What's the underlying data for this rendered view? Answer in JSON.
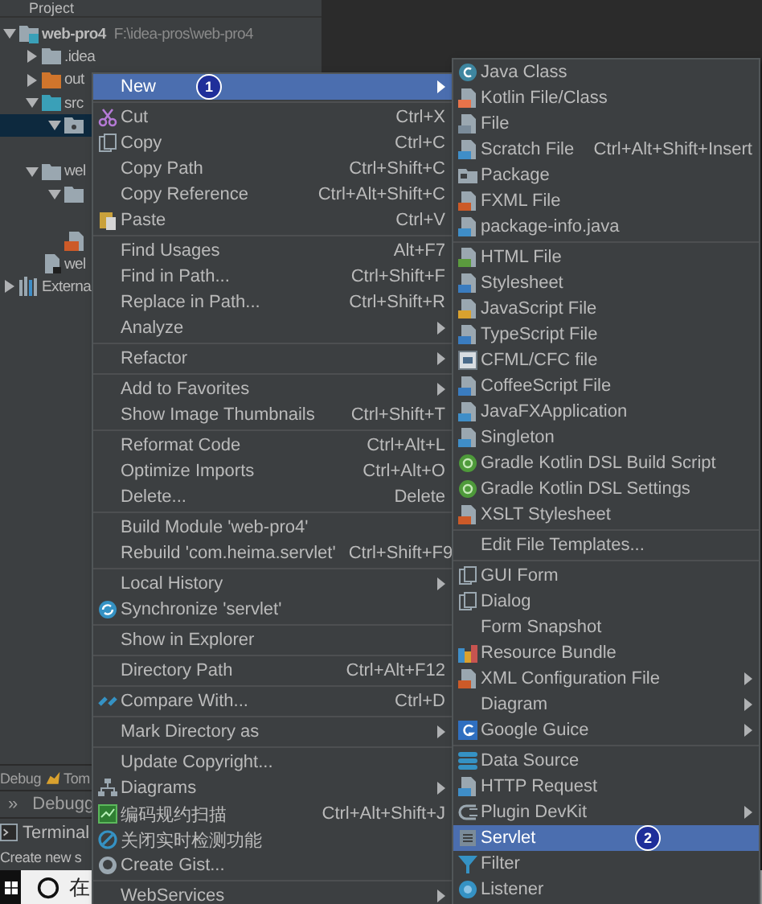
{
  "project_panel": {
    "title": "Project",
    "tree": [
      {
        "kind": "module",
        "label": "web-pro4",
        "path": "F:\\idea-pros\\web-pro4",
        "expanded": true,
        "selected": false,
        "children": [
          {
            "kind": "folder",
            "label": ".idea",
            "expanded": false,
            "selected": false
          },
          {
            "kind": "excluded",
            "label": "out",
            "expanded": false,
            "selected": false
          },
          {
            "kind": "source",
            "label": "src",
            "expanded": true,
            "selected": false,
            "children": [
              {
                "kind": "package",
                "expanded": true,
                "selected": true
              }
            ]
          },
          {
            "kind": "folder",
            "label": "wel",
            "expanded": true,
            "selected": false,
            "children": [
              {
                "kind": "folder",
                "expanded": true,
                "selected": false
              },
              {
                "kind": "jsp",
                "selected": false
              }
            ]
          },
          {
            "kind": "webfile",
            "label": "wel",
            "selected": false
          }
        ]
      },
      {
        "kind": "library",
        "label": "Externa",
        "expanded": false,
        "selected": false
      }
    ]
  },
  "bottom": {
    "debug_bar": [
      {
        "label": "Debug"
      },
      {
        "label": "Tom"
      }
    ],
    "debug_tabs": [
      {
        "label": "»"
      },
      {
        "label": "Debugg"
      }
    ],
    "terminal": {
      "label": "Terminal"
    },
    "status_bar": "Create new s",
    "taskbar": {
      "search_text": "在"
    }
  },
  "context_menu": {
    "groups": [
      [
        {
          "label": "New",
          "submenu": true,
          "selected": true,
          "badge": "1"
        }
      ],
      [
        {
          "label": "Cut",
          "shortcut": "Ctrl+X",
          "submenu": false,
          "selected": false
        },
        {
          "label": "Copy",
          "shortcut": "Ctrl+C",
          "submenu": false,
          "selected": false
        },
        {
          "label": "Copy Path",
          "shortcut": "Ctrl+Shift+C",
          "submenu": false,
          "selected": false
        },
        {
          "label": "Copy Reference",
          "shortcut": "Ctrl+Alt+Shift+C",
          "submenu": false,
          "selected": false
        },
        {
          "label": "Paste",
          "shortcut": "Ctrl+V",
          "submenu": false,
          "selected": false
        }
      ],
      [
        {
          "label": "Find Usages",
          "shortcut": "Alt+F7",
          "submenu": false,
          "selected": false
        },
        {
          "label": "Find in Path...",
          "shortcut": "Ctrl+Shift+F",
          "submenu": false,
          "selected": false
        },
        {
          "label": "Replace in Path...",
          "shortcut": "Ctrl+Shift+R",
          "submenu": false,
          "selected": false
        },
        {
          "label": "Analyze",
          "submenu": true,
          "selected": false
        }
      ],
      [
        {
          "label": "Refactor",
          "submenu": true,
          "selected": false
        }
      ],
      [
        {
          "label": "Add to Favorites",
          "submenu": true,
          "selected": false
        },
        {
          "label": "Show Image Thumbnails",
          "shortcut": "Ctrl+Shift+T",
          "submenu": false,
          "selected": false
        }
      ],
      [
        {
          "label": "Reformat Code",
          "shortcut": "Ctrl+Alt+L",
          "submenu": false,
          "selected": false
        },
        {
          "label": "Optimize Imports",
          "shortcut": "Ctrl+Alt+O",
          "submenu": false,
          "selected": false
        },
        {
          "label": "Delete...",
          "shortcut": "Delete",
          "submenu": false,
          "selected": false
        }
      ],
      [
        {
          "label": "Build Module 'web-pro4'",
          "submenu": false,
          "selected": false
        },
        {
          "label": "Rebuild 'com.heima.servlet'",
          "shortcut": "Ctrl+Shift+F9",
          "submenu": false,
          "selected": false
        }
      ],
      [
        {
          "label": "Local History",
          "submenu": true,
          "selected": false
        },
        {
          "label": "Synchronize 'servlet'",
          "submenu": false,
          "selected": false
        }
      ],
      [
        {
          "label": "Show in Explorer",
          "submenu": false,
          "selected": false
        }
      ],
      [
        {
          "label": "Directory Path",
          "shortcut": "Ctrl+Alt+F12",
          "submenu": false,
          "selected": false
        }
      ],
      [
        {
          "label": "Compare With...",
          "shortcut": "Ctrl+D",
          "submenu": false,
          "selected": false
        }
      ],
      [
        {
          "label": "Mark Directory as",
          "submenu": true,
          "selected": false
        }
      ],
      [
        {
          "label": "Update Copyright...",
          "submenu": false,
          "selected": false
        },
        {
          "label": "Diagrams",
          "submenu": true,
          "selected": false
        },
        {
          "label": "编码规约扫描",
          "shortcut": "Ctrl+Alt+Shift+J",
          "submenu": false,
          "selected": false
        },
        {
          "label": "关闭实时检测功能",
          "submenu": false,
          "selected": false
        },
        {
          "label": "Create Gist...",
          "submenu": false,
          "selected": false
        }
      ],
      [
        {
          "label": "WebServices",
          "submenu": true,
          "selected": false
        }
      ]
    ]
  },
  "new_submenu": {
    "groups": [
      [
        {
          "label": "Java Class",
          "submenu": false,
          "selected": false
        },
        {
          "label": "Kotlin File/Class",
          "submenu": false,
          "selected": false
        },
        {
          "label": "File",
          "submenu": false,
          "selected": false
        },
        {
          "label": "Scratch File",
          "shortcut": "Ctrl+Alt+Shift+Insert",
          "submenu": false,
          "selected": false
        },
        {
          "label": "Package",
          "submenu": false,
          "selected": false
        },
        {
          "label": "FXML File",
          "submenu": false,
          "selected": false
        },
        {
          "label": "package-info.java",
          "submenu": false,
          "selected": false
        }
      ],
      [
        {
          "label": "HTML File",
          "submenu": false,
          "selected": false
        },
        {
          "label": "Stylesheet",
          "submenu": false,
          "selected": false
        },
        {
          "label": "JavaScript File",
          "submenu": false,
          "selected": false
        },
        {
          "label": "TypeScript File",
          "submenu": false,
          "selected": false
        },
        {
          "label": "CFML/CFC file",
          "submenu": false,
          "selected": false
        },
        {
          "label": "CoffeeScript File",
          "submenu": false,
          "selected": false
        },
        {
          "label": "JavaFXApplication",
          "submenu": false,
          "selected": false
        },
        {
          "label": "Singleton",
          "submenu": false,
          "selected": false
        },
        {
          "label": "Gradle Kotlin DSL Build Script",
          "submenu": false,
          "selected": false
        },
        {
          "label": "Gradle Kotlin DSL Settings",
          "submenu": false,
          "selected": false
        },
        {
          "label": "XSLT Stylesheet",
          "submenu": false,
          "selected": false
        }
      ],
      [
        {
          "label": "Edit File Templates...",
          "submenu": false,
          "selected": false
        }
      ],
      [
        {
          "label": "GUI Form",
          "submenu": false,
          "selected": false
        },
        {
          "label": "Dialog",
          "submenu": false,
          "selected": false
        },
        {
          "label": "Form Snapshot",
          "submenu": false,
          "selected": false
        },
        {
          "label": "Resource Bundle",
          "submenu": false,
          "selected": false
        },
        {
          "label": "XML Configuration File",
          "submenu": true,
          "selected": false
        },
        {
          "label": "Diagram",
          "submenu": true,
          "selected": false
        },
        {
          "label": "Google Guice",
          "submenu": true,
          "selected": false
        }
      ],
      [
        {
          "label": "Data Source",
          "submenu": false,
          "selected": false
        },
        {
          "label": "HTTP Request",
          "submenu": false,
          "selected": false
        },
        {
          "label": "Plugin DevKit",
          "submenu": true,
          "selected": false
        },
        {
          "label": "Servlet",
          "submenu": false,
          "selected": true,
          "badge": "2"
        },
        {
          "label": "Filter",
          "submenu": false,
          "selected": false
        },
        {
          "label": "Listener",
          "submenu": false,
          "selected": false
        }
      ]
    ]
  }
}
